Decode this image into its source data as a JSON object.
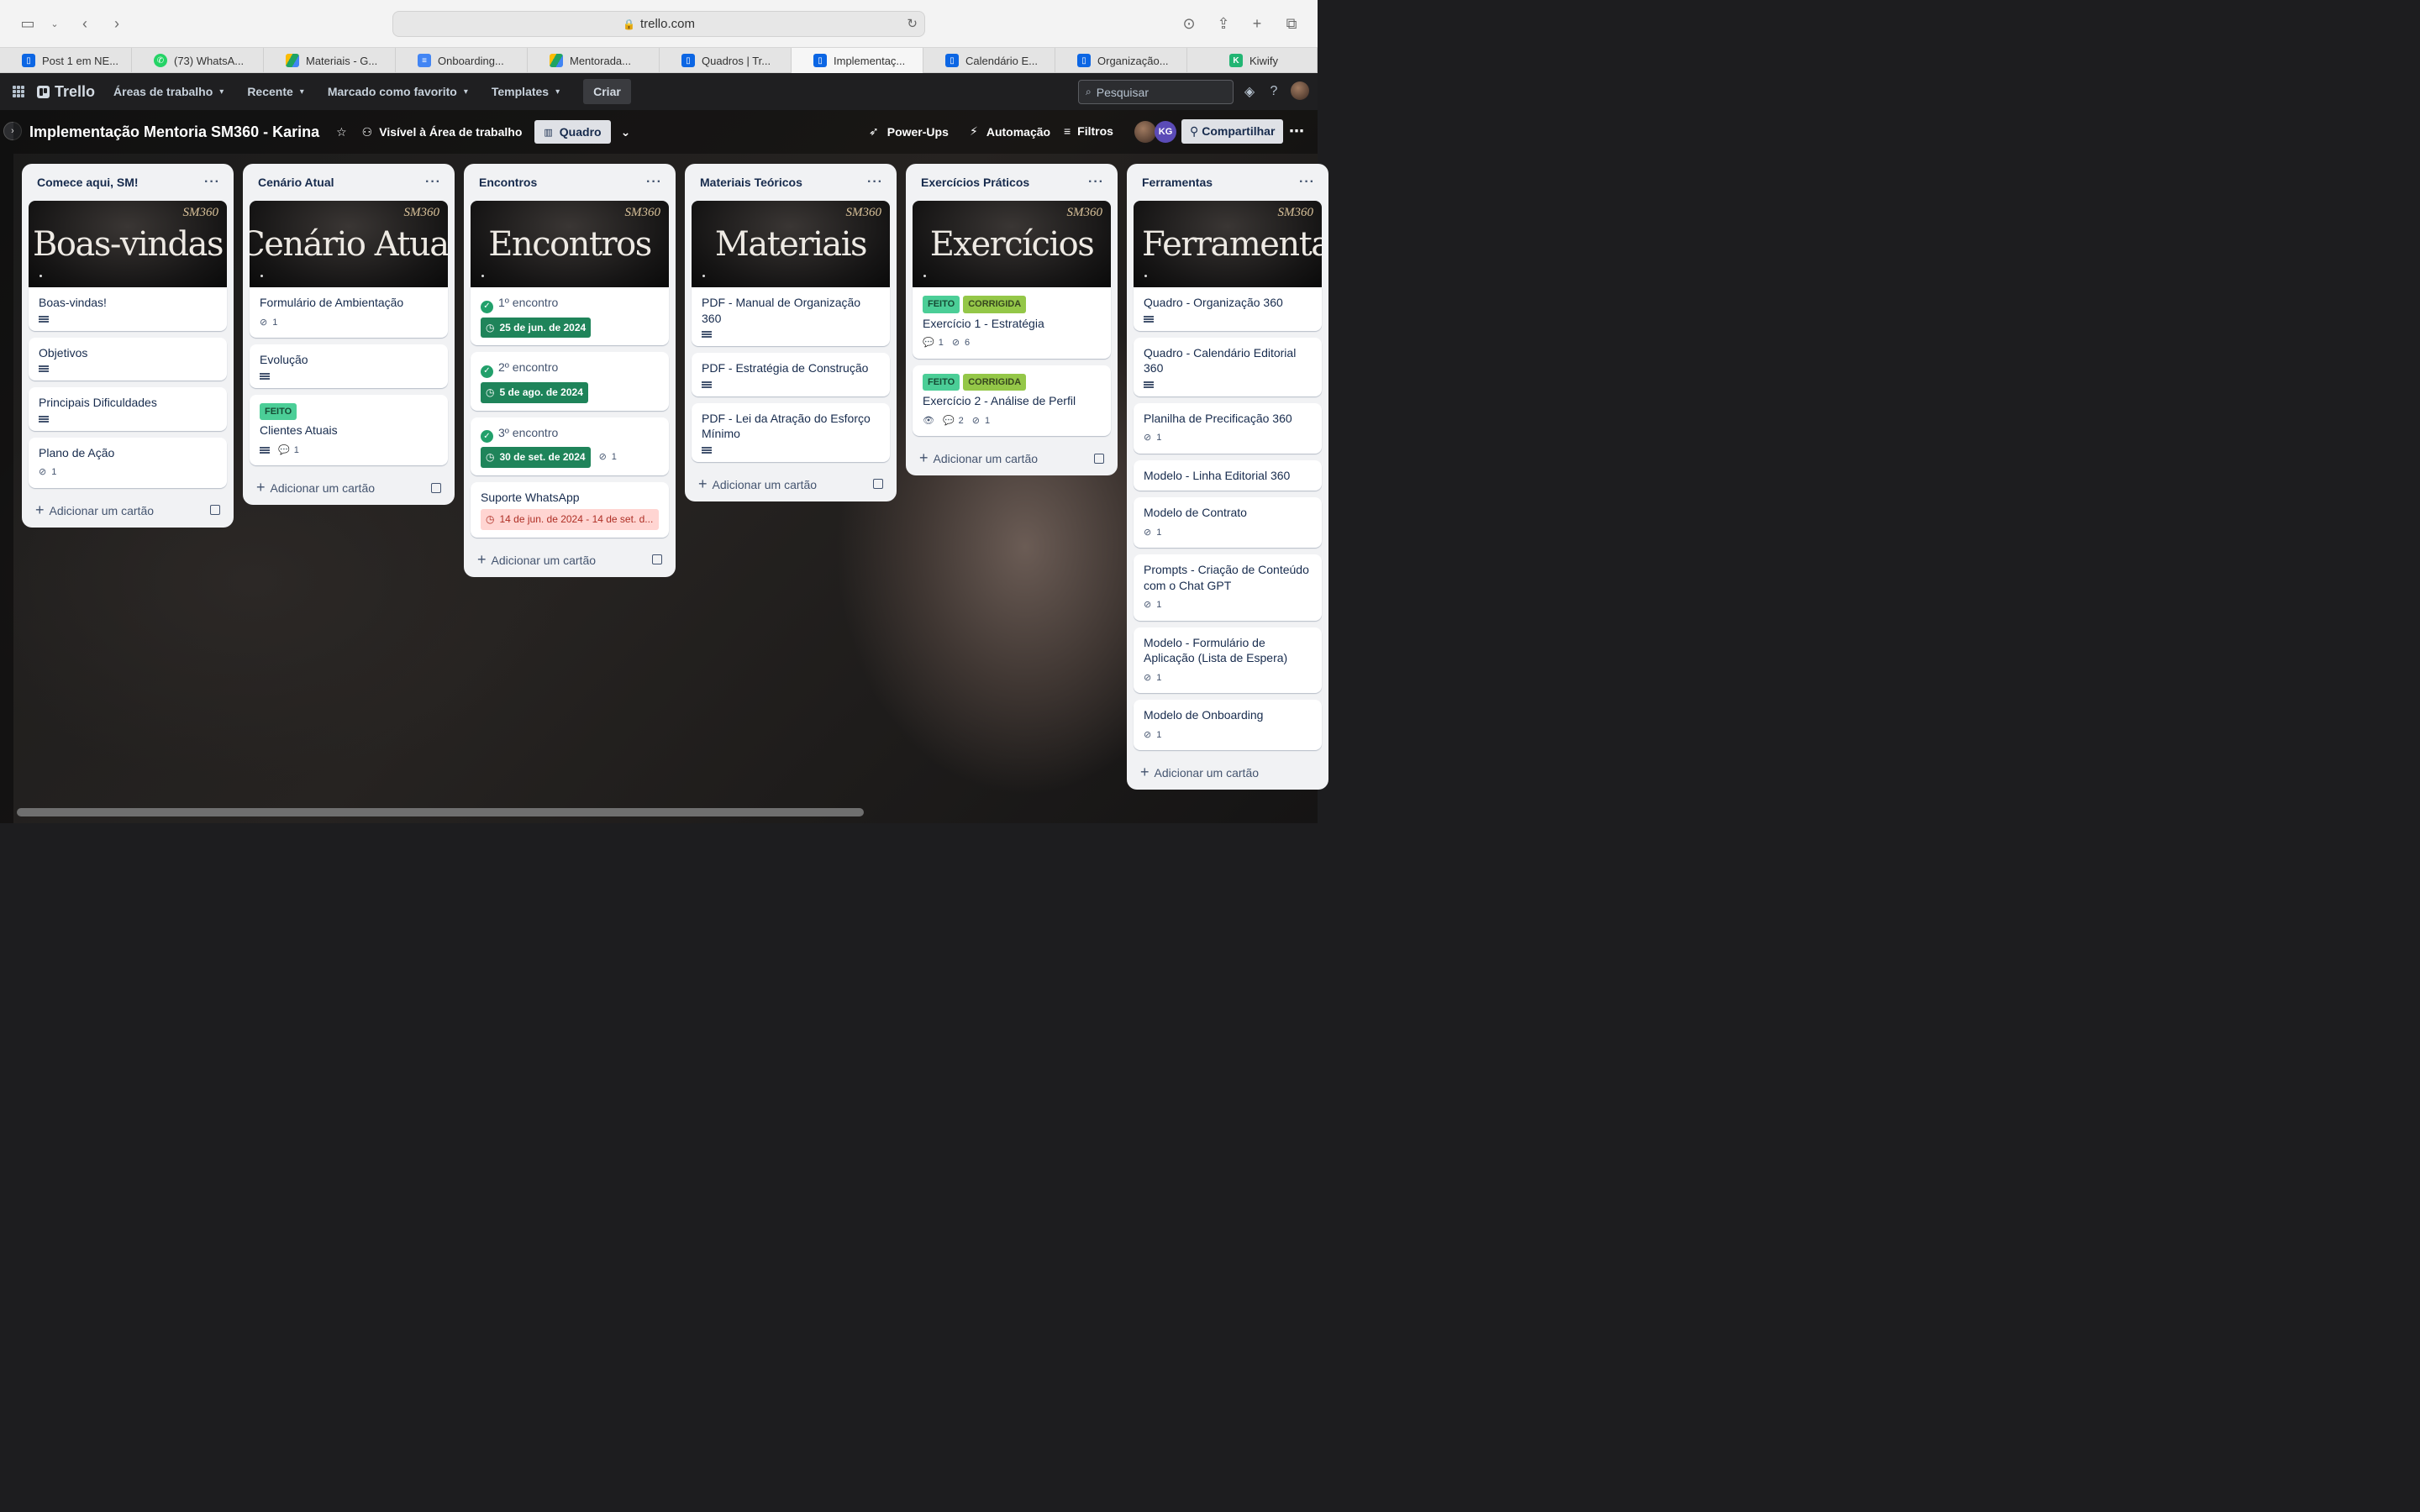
{
  "browser": {
    "url": "trello.com",
    "tabs": [
      {
        "label": "Post 1 em NE...",
        "icon": "trello-icon",
        "color": "#0c66e4"
      },
      {
        "label": "(73) WhatsA...",
        "icon": "whatsapp-icon",
        "color": "#25d366"
      },
      {
        "label": "Materiais - G...",
        "icon": "google-drive-icon",
        "color": "#1fa463"
      },
      {
        "label": "Onboarding...",
        "icon": "google-docs-icon",
        "color": "#4285f4"
      },
      {
        "label": "Mentorada...",
        "icon": "google-drive-icon",
        "color": "#1fa463"
      },
      {
        "label": "Quadros | Tr...",
        "icon": "trello-icon",
        "color": "#0c66e4"
      },
      {
        "label": "Implementaç...",
        "icon": "trello-icon",
        "color": "#0c66e4",
        "active": true
      },
      {
        "label": "Calendário E...",
        "icon": "trello-icon",
        "color": "#0c66e4"
      },
      {
        "label": "Organização...",
        "icon": "trello-icon",
        "color": "#0c66e4"
      },
      {
        "label": "Kiwify",
        "icon": "kiwify-icon",
        "color": "#22b573"
      }
    ]
  },
  "header": {
    "logo": "Trello",
    "nav": [
      "Áreas de trabalho",
      "Recente",
      "Marcado como favorito",
      "Templates"
    ],
    "create": "Criar",
    "search_placeholder": "Pesquisar"
  },
  "board": {
    "title": "Implementação Mentoria SM360 - Karina",
    "visibility": "Visível à Área de trabalho",
    "view": "Quadro",
    "powerups": "Power-Ups",
    "automation": "Automação",
    "filters": "Filtros",
    "member_initials": "KG",
    "share": "Compartilhar"
  },
  "add_card_label": "Adicionar um cartão",
  "cover_brand": "SM360",
  "lists": {
    "l1": {
      "title": "Comece aqui, SM!",
      "cover": "Boas-vindas",
      "cards": [
        "Boas-vindas!",
        "Objetivos",
        "Principais Dificuldades",
        "Plano de Ação"
      ],
      "c4_attach": "1"
    },
    "l2": {
      "title": "Cenário Atual",
      "cover": "Cenário Atual",
      "cards": [
        "Formulário de Ambientação",
        "Evolução",
        "Clientes Atuais"
      ],
      "c1_attach": "1",
      "c3_label": "FEITO",
      "c3_comments": "1"
    },
    "l3": {
      "title": "Encontros",
      "cover": "Encontros",
      "cards": [
        "1º encontro",
        "2º encontro",
        "3º encontro",
        "Suporte WhatsApp"
      ],
      "dates": [
        "25 de jun. de 2024",
        "5 de ago. de 2024",
        "30 de set. de 2024",
        "14 de jun. de 2024 - 14 de set. d..."
      ],
      "c3_attach": "1"
    },
    "l4": {
      "title": "Materiais Teóricos",
      "cover": "Materiais",
      "cards": [
        "PDF - Manual de Organização 360",
        "PDF - Estratégia de Construção",
        "PDF - Lei da Atração do Esforço Mínimo"
      ]
    },
    "l5": {
      "title": "Exercícios Práticos",
      "cover": "Exercícios",
      "labels": [
        "FEITO",
        "CORRIGIDA"
      ],
      "cards": [
        "Exercício 1 - Estratégia",
        "Exercício 2 - Análise de Perfil"
      ],
      "c1_comments": "1",
      "c1_attach": "6",
      "c2_comments": "2",
      "c2_attach": "1"
    },
    "l6": {
      "title": "Ferramentas",
      "cover": "Ferramentas",
      "cards": [
        "Quadro - Organização 360",
        "Quadro - Calendário Editorial 360",
        "Planilha de Precificação 360",
        "Modelo - Linha Editorial 360",
        "Modelo de Contrato",
        "Prompts - Criação de Conteúdo com o Chat GPT",
        "Modelo - Formulário de Aplicação (Lista de Espera)",
        "Modelo de Onboarding"
      ],
      "attach": "1"
    }
  }
}
